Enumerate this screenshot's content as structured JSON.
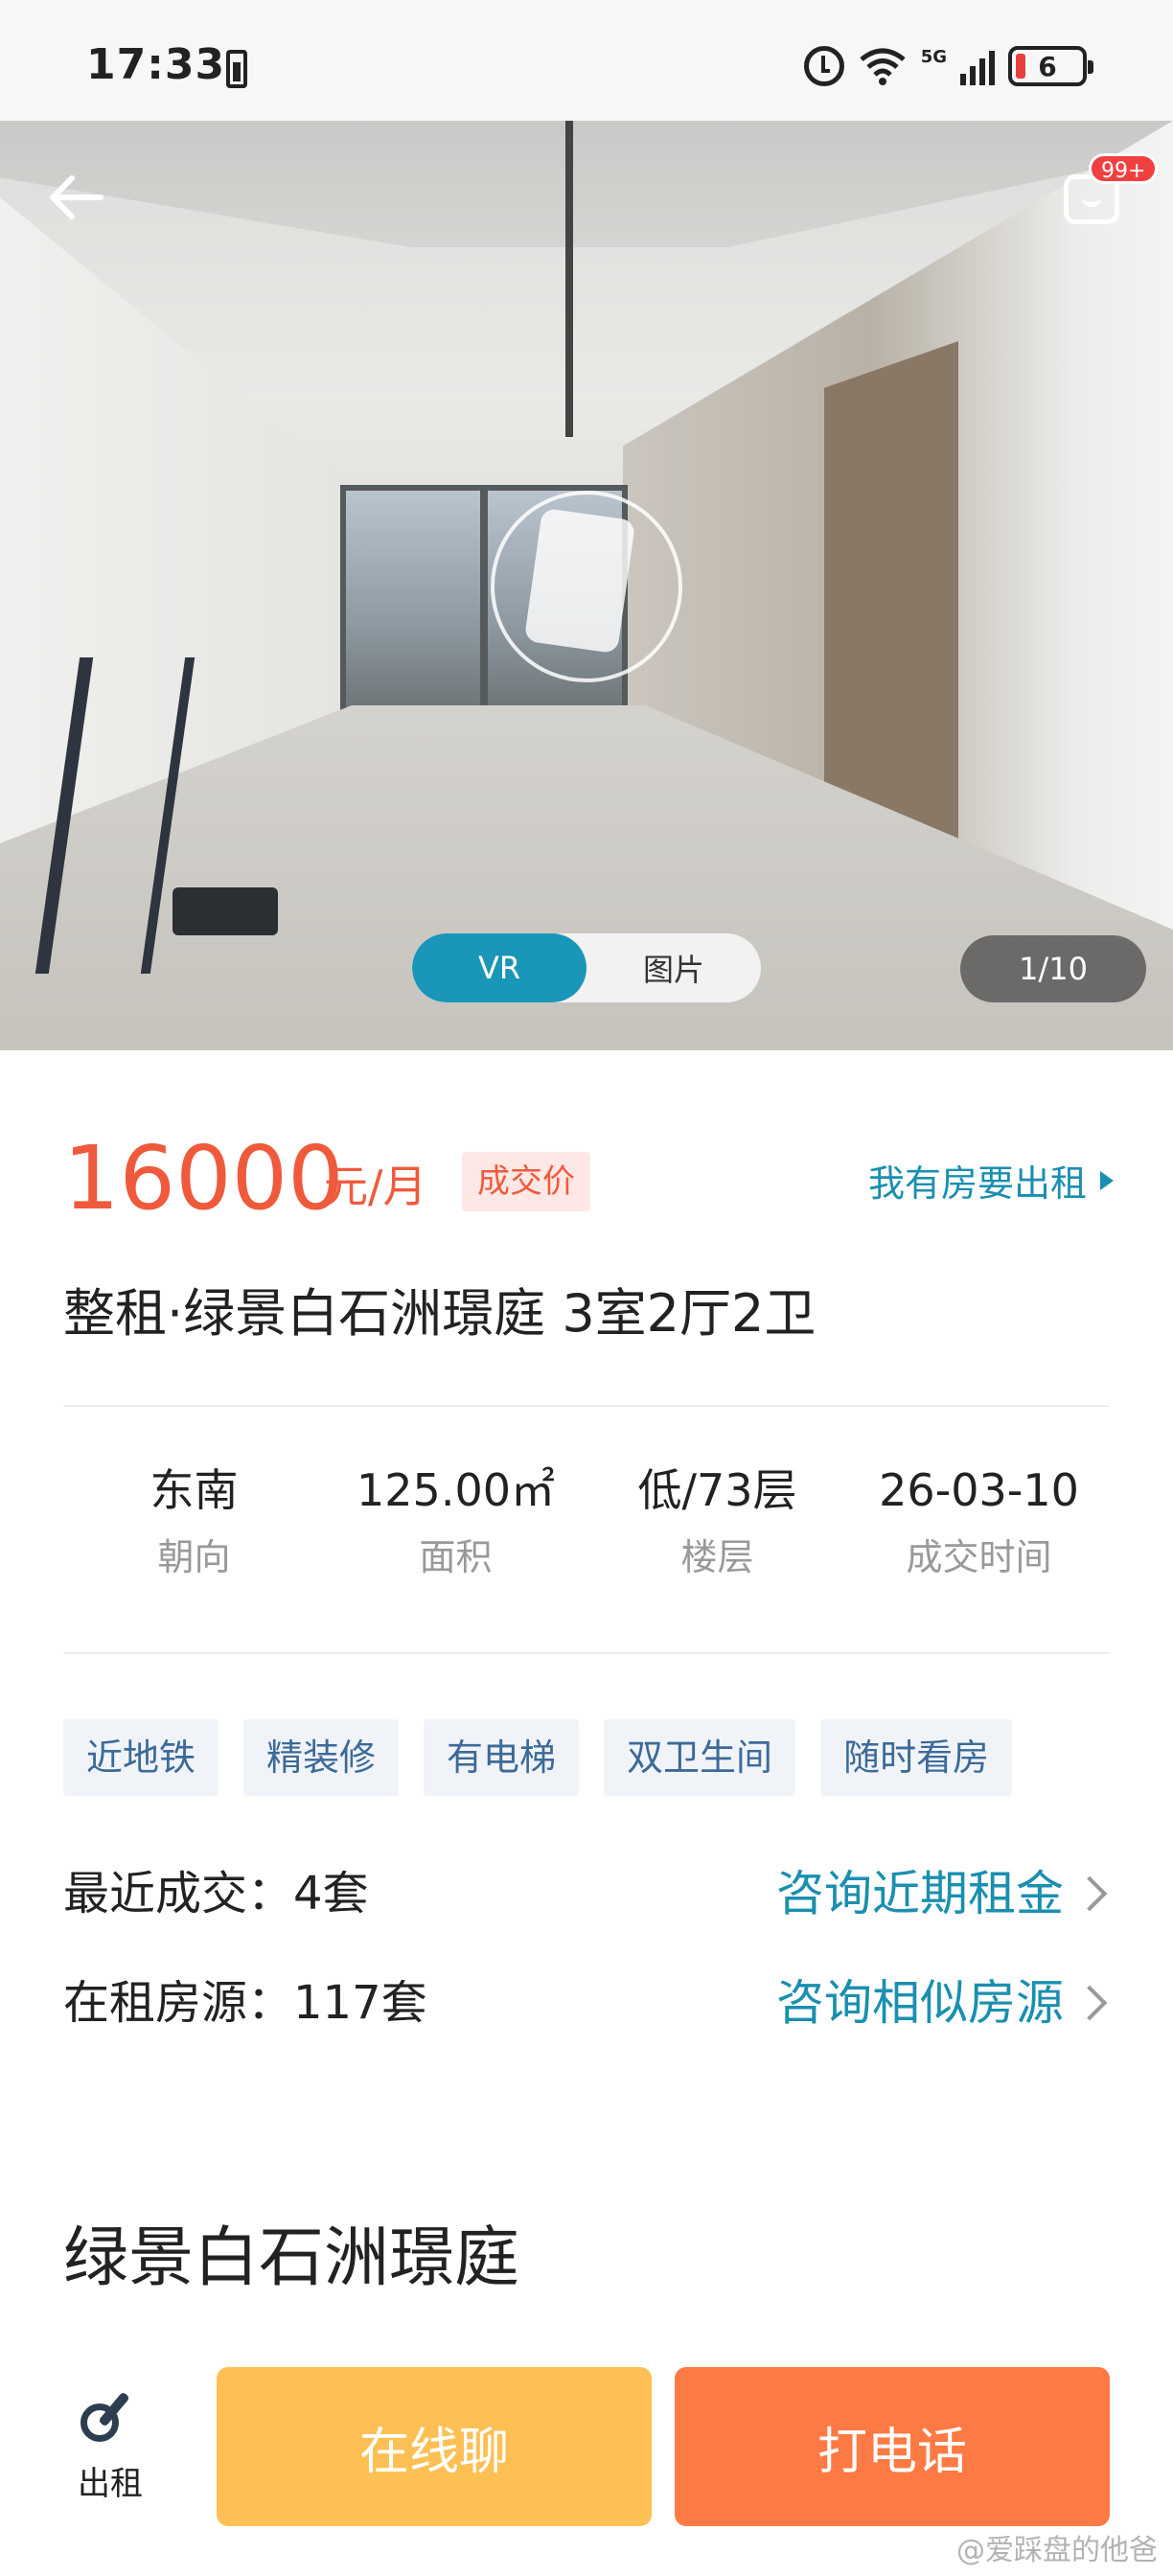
{
  "status_bar": {
    "time": "17:33",
    "network": "5G",
    "wifi_badge": "6",
    "battery": "6"
  },
  "hero": {
    "message_badge": "99+",
    "toggle": {
      "vr_label": "VR",
      "photo_label": "图片",
      "active": "VR"
    },
    "counter": "1/10"
  },
  "listing": {
    "price": "16000",
    "price_unit": "元/月",
    "deal_badge": "成交价",
    "rent_out_link": "我有房要出租",
    "title": "整租·绿景白石洲璟庭 3室2厅2卫",
    "stats": [
      {
        "value": "东南",
        "label": "朝向"
      },
      {
        "value": "125.00㎡",
        "label": "面积"
      },
      {
        "value": "低/73层",
        "label": "楼层"
      },
      {
        "value": "26-03-10",
        "label": "成交时间"
      }
    ],
    "tags": [
      "近地铁",
      "精装修",
      "有电梯",
      "双卫生间",
      "随时看房"
    ],
    "recent_deals": {
      "key": "最近成交：4套",
      "link": "咨询近期租金"
    },
    "active_listings": {
      "key": "在租房源：117套",
      "link": "咨询相似房源"
    },
    "community_name": "绿景白石洲璟庭"
  },
  "bottom_bar": {
    "rent_label": "出租",
    "chat_label": "在线聊",
    "call_label": "打电话"
  },
  "watermark": "@爱踩盘的他爸",
  "colors": {
    "accent_teal": "#1996b8",
    "price_red": "#f05a3c",
    "chat_yellow": "#fec054",
    "call_orange": "#fe7a45"
  }
}
